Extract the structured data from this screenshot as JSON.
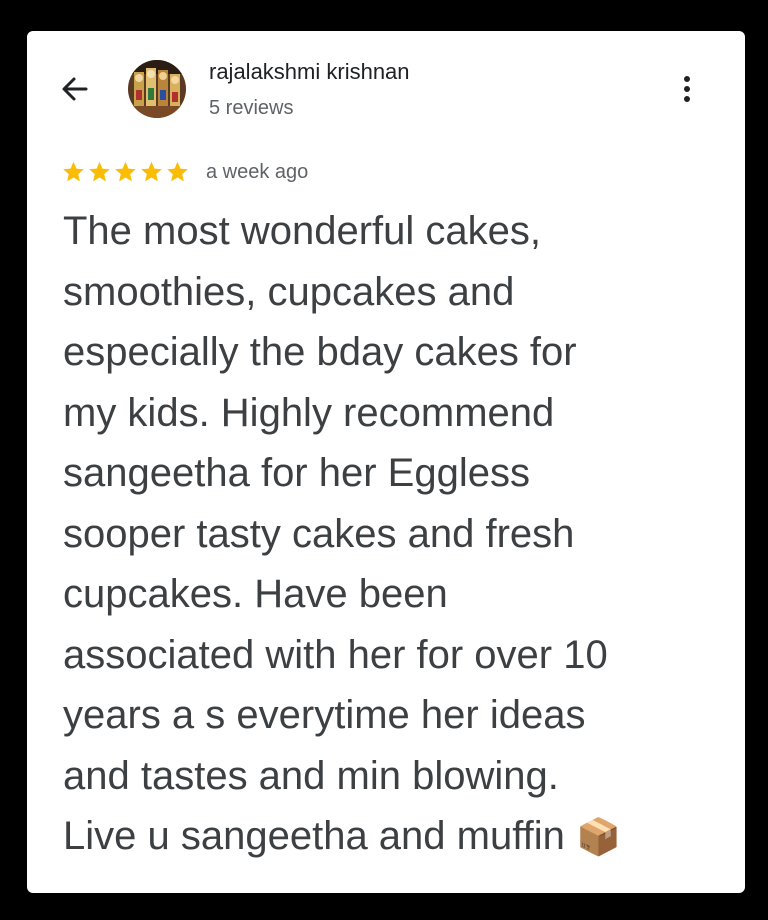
{
  "header": {
    "back_icon": "arrow-left-icon",
    "avatar_icon": "profile-photo",
    "reviewer_name": "rajalakshmi krishnan",
    "review_count": "5 reviews",
    "more_icon": "more-vert-icon"
  },
  "review": {
    "rating": 5,
    "rating_max": 5,
    "star_color": "#fbbc04",
    "time": "a week ago",
    "text": "The most wonderful cakes,\nsmoothies, cupcakes and\nespecially the bday cakes for\nmy kids.  Highly recommend\nsangeetha for her Eggless\nsooper tasty cakes and fresh\ncupcakes. Have been\nassociated with her for over 10\nyears a s everytime her ideas\nand tastes and min blowing.\nLive u sangeetha and muffin",
    "emoji": "📦"
  }
}
